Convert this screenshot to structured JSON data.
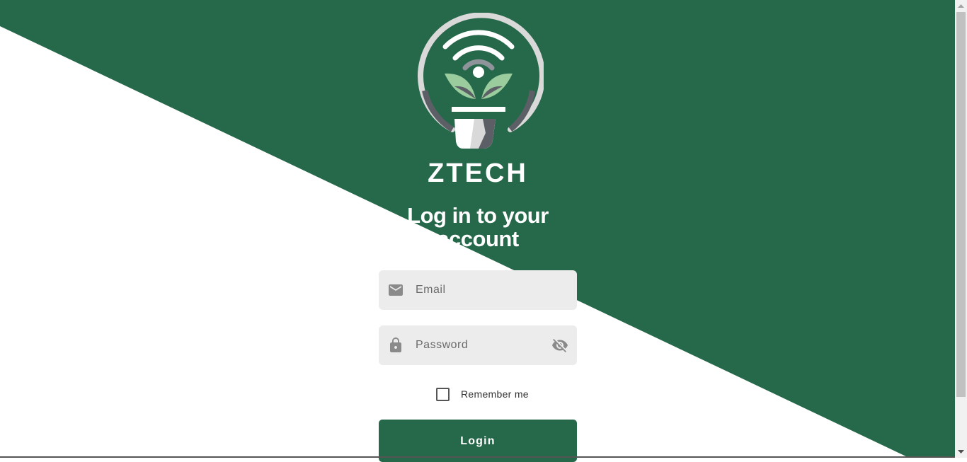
{
  "brand": {
    "name": "ZTECH"
  },
  "heading": {
    "line1": "Log in to your",
    "line2": "account"
  },
  "form": {
    "email": {
      "placeholder": "Email",
      "value": "",
      "icon": "mail-icon"
    },
    "password": {
      "placeholder": "Password",
      "value": "",
      "icon": "lock-icon",
      "toggle_icon": "eye-off-icon"
    },
    "remember": {
      "label": "Remember me",
      "checked": false
    },
    "submit_label": "Login"
  },
  "colors": {
    "primary": "#26684a",
    "field_bg": "#ececec",
    "icon_gray": "#8a8a8a"
  }
}
